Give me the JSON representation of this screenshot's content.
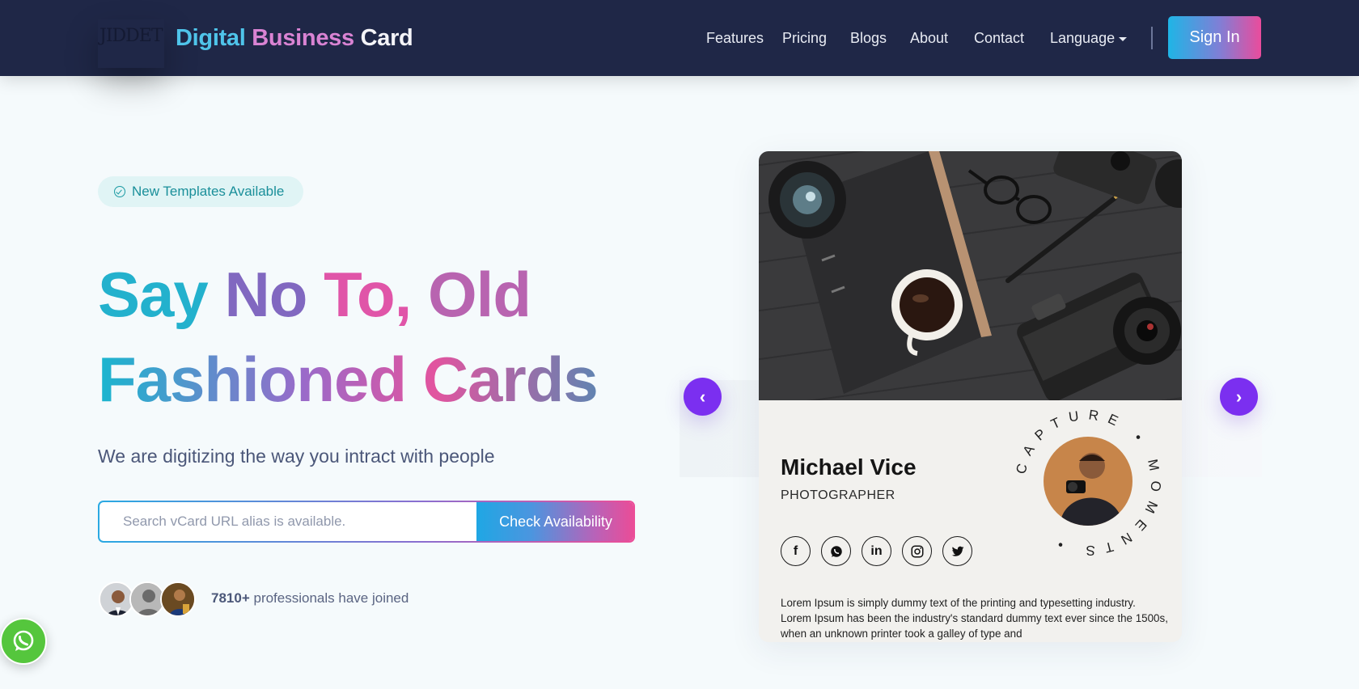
{
  "navbar": {
    "logo_text": "JIDDET",
    "brand": {
      "part1": "Digital",
      "part2": "Business",
      "part3": "Card"
    },
    "links": [
      "Features",
      "Pricing",
      "Blogs",
      "About",
      "Contact"
    ],
    "language_label": "Language",
    "signin_label": "Sign In"
  },
  "hero": {
    "badge": "New Templates Available",
    "title_line1": [
      "Say",
      "No",
      "To,",
      "Old"
    ],
    "title_line2": "Fashioned Cards",
    "subtitle": "We are digitizing the way you intract with people",
    "search_placeholder": "Search vCard URL alias is available.",
    "check_button": "Check Availability",
    "joined_count": "7810+",
    "joined_text": "professionals have joined"
  },
  "vcard": {
    "name": "Michael Vice",
    "role": "PHOTOGRAPHER",
    "ring_text": "CAPTURE • MOMENTS •",
    "social_icons": [
      "facebook-icon",
      "whatsapp-icon",
      "linkedin-icon",
      "instagram-icon",
      "twitter-icon"
    ],
    "description": "Lorem Ipsum is simply dummy text of the printing and typesetting industry. Lorem Ipsum has been the industry's standard dummy text ever since the 1500s, when an unknown printer took a galley of type and"
  },
  "colors": {
    "navbar_bg": "#1f2747",
    "accent_cyan": "#1fb5e6",
    "accent_pink": "#ea4c9c",
    "arrow_purple": "#7b2ff0",
    "whatsapp_green": "#55c63d"
  }
}
